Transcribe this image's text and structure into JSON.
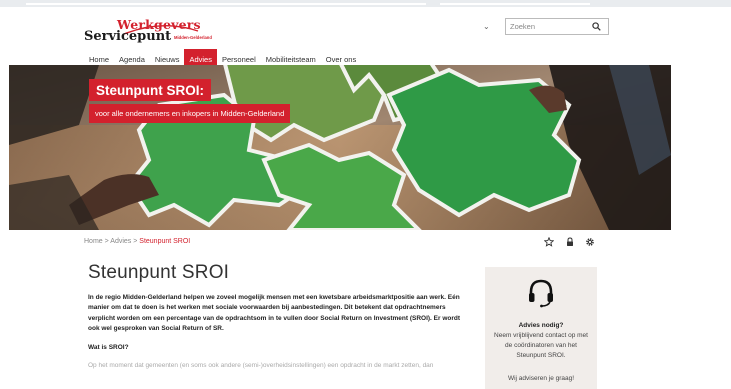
{
  "header": {
    "logo": {
      "line1": "Werkgevers",
      "line2": "Servicepunt",
      "tagline": "Midden-Gelderland"
    },
    "language_chevron": "⌄",
    "search": {
      "placeholder": "Zoeken",
      "value": ""
    },
    "nav": [
      {
        "label": "Home",
        "active": false
      },
      {
        "label": "Agenda",
        "active": false
      },
      {
        "label": "Nieuws",
        "active": false
      },
      {
        "label": "Advies",
        "active": true
      },
      {
        "label": "Personeel",
        "active": false
      },
      {
        "label": "Mobiliteitsteam",
        "active": false
      },
      {
        "label": "Over ons",
        "active": false
      }
    ]
  },
  "hero": {
    "title": "Steunpunt SROI:",
    "subtitle": "voor alle ondernemers en inkopers in Midden-Gelderland"
  },
  "breadcrumb": {
    "home": "Home",
    "sep1": " > ",
    "advies": "Advies",
    "sep2": " > ",
    "current": "Steunpunt SROI"
  },
  "tools": {
    "icons": [
      "star-icon",
      "lock-icon",
      "gear-icon"
    ]
  },
  "content": {
    "title": "Steunpunt SROI",
    "intro": "In de regio Midden-Gelderland helpen we zoveel mogelijk mensen met een kwetsbare arbeidsmarktpositie aan werk. Eén manier om dat te doen is het werken met sociale voorwaarden bij aanbestedingen. Dit betekent dat opdrachtnemers verplicht worden om een percentage van de opdrachtsom in te vullen door Social Return on Investment (SROI). Er wordt ook wel gesproken van Social Return of SR.",
    "question": "Wat is SROI?",
    "paragraph": "Op het moment dat gemeenten (en soms ook andere (semi-)overheidsinstellingen) een opdracht in de markt zetten, dan"
  },
  "sidebox": {
    "title": "Advies nodig?",
    "text": "Neem vrijblijvend contact op met de coördinatoren van het Steunpunt SROI.",
    "cta": "Wij adviseren je graag!"
  },
  "colors": {
    "brand_red": "#d3212d",
    "sidebar_bg": "#f1edea",
    "puzzle_green": "#2f9a46"
  }
}
